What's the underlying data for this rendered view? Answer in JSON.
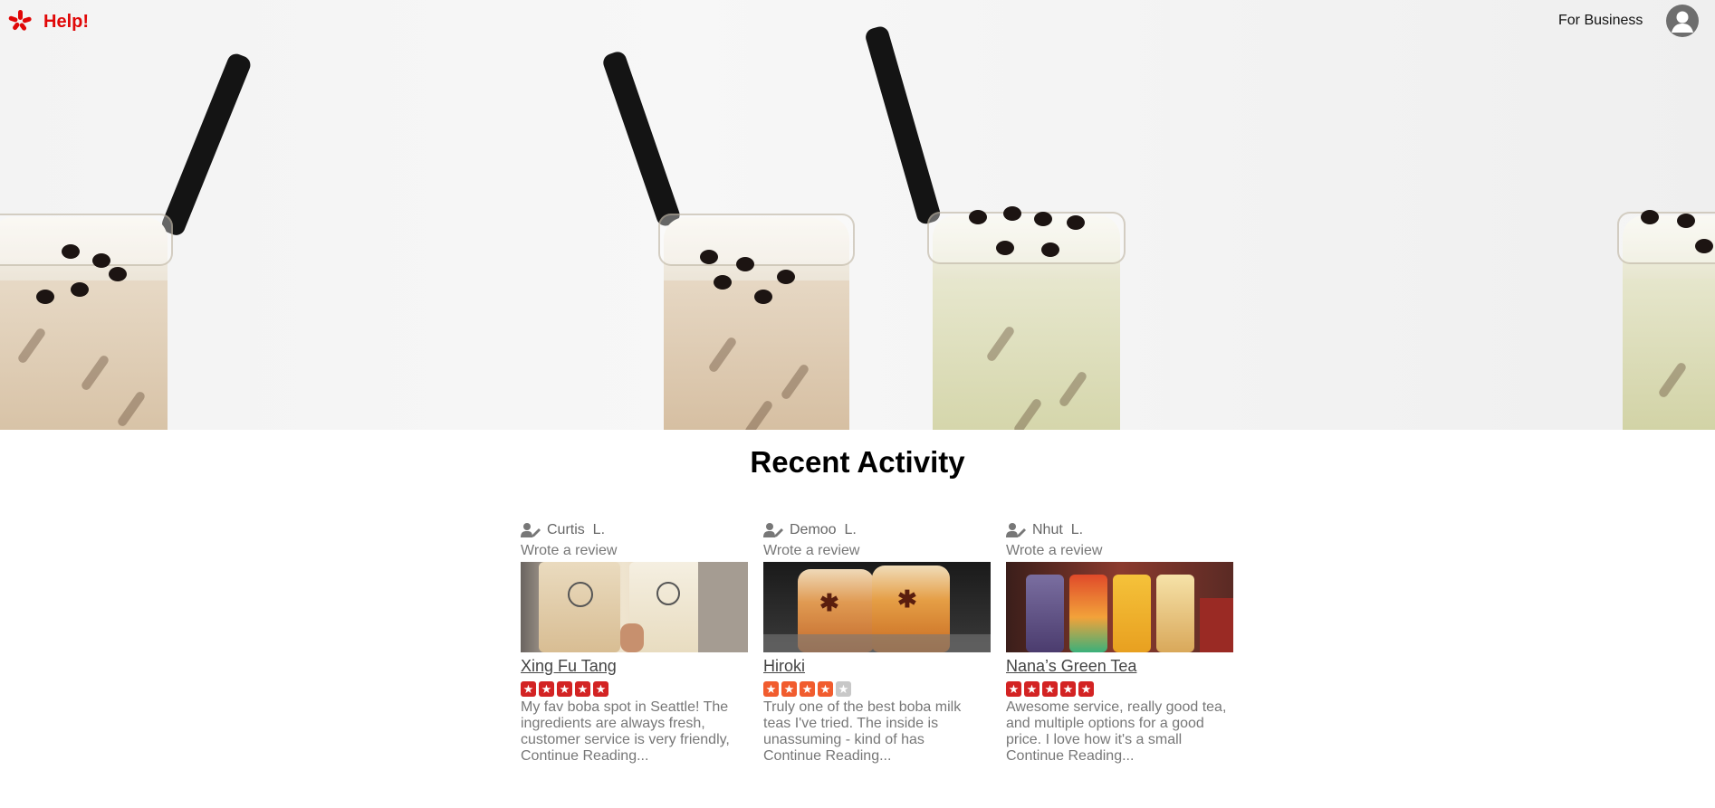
{
  "header": {
    "logo_text": "Help!",
    "for_business": "For Business",
    "brand_color": "#e00707",
    "logo_icon": "burst-logo-icon",
    "avatar_icon": "user-avatar-icon"
  },
  "hero": {
    "description_icon": "boba-tea-hero-image"
  },
  "section": {
    "title": "Recent Activity"
  },
  "cards": [
    {
      "user": "Curtis  L.",
      "action": "Wrote a review",
      "business": "Xing Fu Tang",
      "rating": 5,
      "star_color": "#d32323",
      "snippet": "My fav boba spot in Seattle! The ingredients are always fresh, customer service is very friendly,",
      "more": "Continue Reading..."
    },
    {
      "user": "Demoo  L.",
      "action": "Wrote a review",
      "business": "Hiroki",
      "rating": 4,
      "star_color": "#f15c2e",
      "snippet": "Truly one of the best boba milk teas I've tried. The inside is unassuming - kind of has",
      "more": "Continue Reading..."
    },
    {
      "user": "Nhut  L.",
      "action": "Wrote a review",
      "business": "Nana’s Green Tea",
      "rating": 5,
      "star_color": "#d32323",
      "snippet": "Awesome service, really good tea, and multiple options for a good price. I love how it's a small",
      "more": "Continue Reading..."
    }
  ]
}
